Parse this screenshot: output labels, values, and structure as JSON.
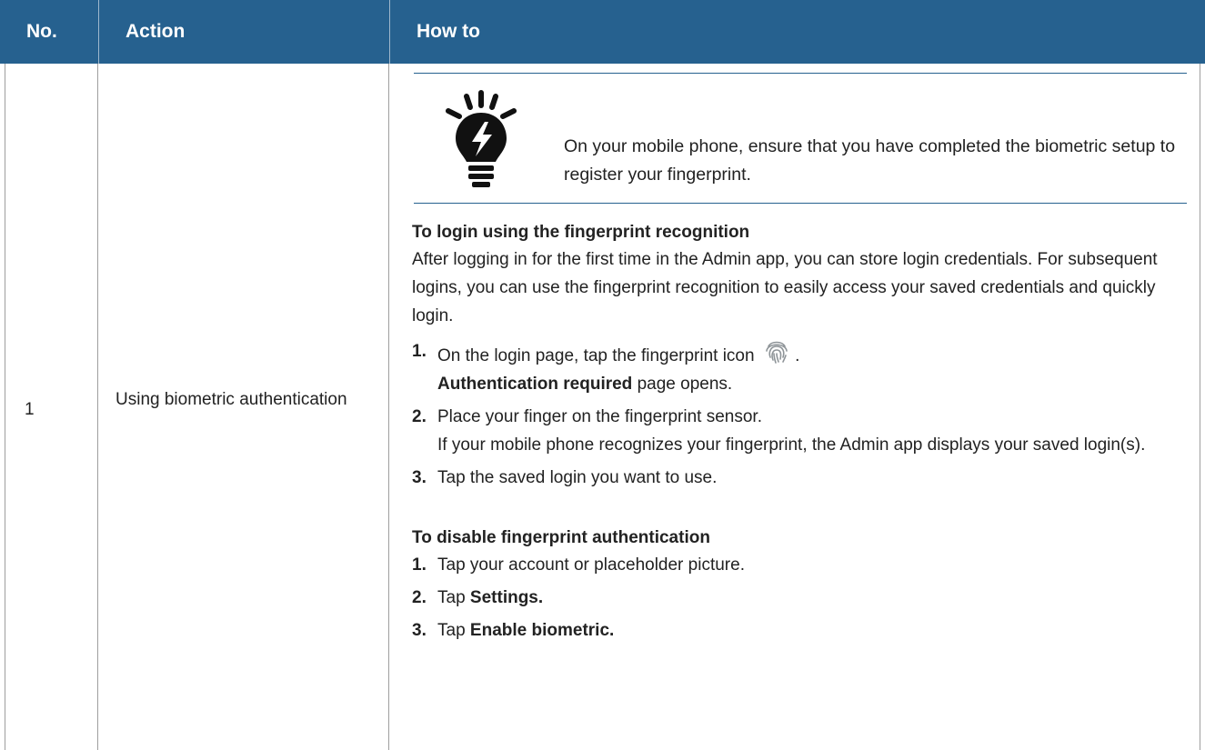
{
  "header": {
    "col_no": "No.",
    "col_action": "Action",
    "col_howto": "How to"
  },
  "row": {
    "number": "1",
    "action": "Using biometric authentication"
  },
  "note": {
    "text": "On your mobile phone, ensure that you have completed the biometric setup to register your fingerprint."
  },
  "login_section": {
    "title": "To login using the fingerprint recognition",
    "intro": "After logging in for the first time in the Admin app, you can store login credentials. For subsequent logins, you can use the fingerprint recognition to easily access your saved credentials and quickly login.",
    "steps": [
      {
        "num": "1.",
        "text": "On the login page, tap the fingerprint icon",
        "after_icon": ".",
        "sub_bold": "Authentication required",
        "sub_rest": " page opens."
      },
      {
        "num": "2.",
        "text": "Place your finger on the fingerprint sensor.",
        "sub": "If your mobile phone recognizes your fingerprint, the Admin app displays your saved login(s)."
      },
      {
        "num": "3.",
        "text": "Tap the saved login you want to use."
      }
    ]
  },
  "disable_section": {
    "title": "To disable fingerprint authentication",
    "steps": [
      {
        "num": "1.",
        "text": "Tap your account or placeholder picture."
      },
      {
        "num": "2.",
        "prefix": "Tap ",
        "bold": "Settings."
      },
      {
        "num": "3.",
        "prefix": "Tap ",
        "bold": "Enable biometric."
      }
    ]
  },
  "colors": {
    "header_bg": "#26618f",
    "header_text": "#ffffff",
    "rule": "#26618f",
    "grid": "#9e9e9e"
  },
  "icons": {
    "tip": "lightbulb-icon",
    "fingerprint": "fingerprint-icon"
  }
}
